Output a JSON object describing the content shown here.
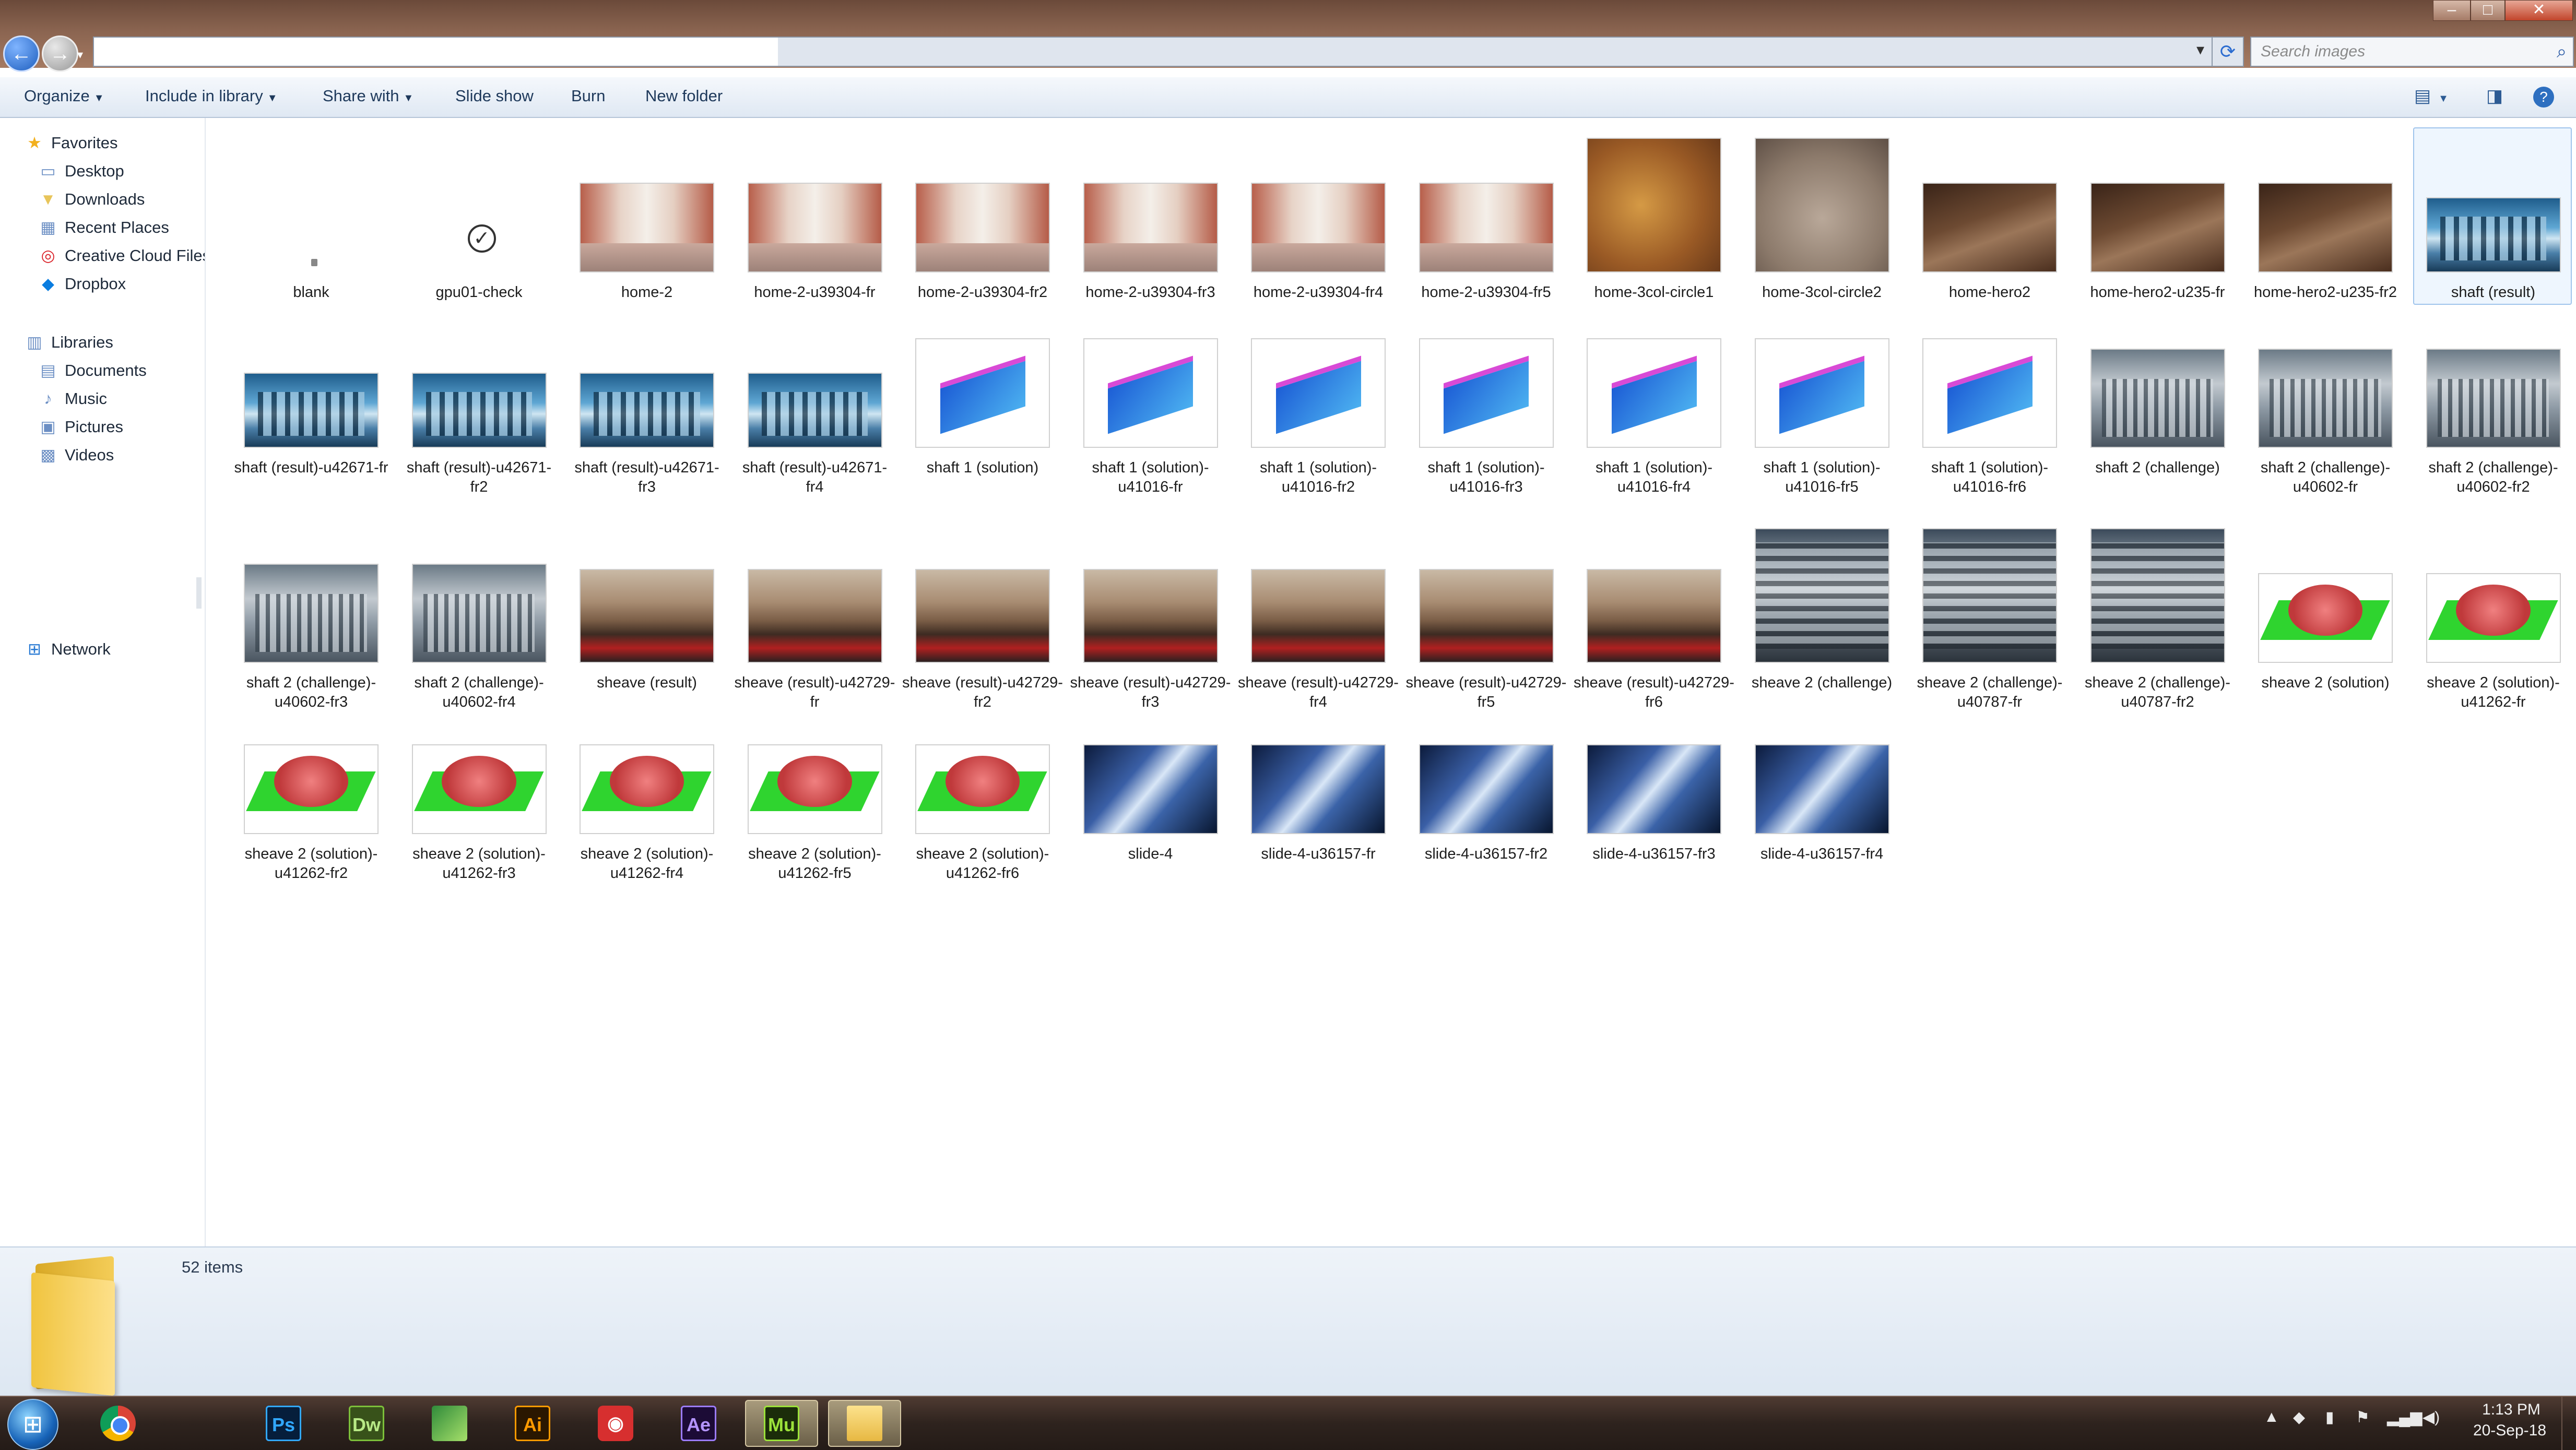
{
  "window": {
    "controls": {
      "minimize": "–",
      "maximize": "□",
      "close": "✕"
    },
    "nav": {
      "back_icon": "back-arrow-icon",
      "forward_icon": "forward-arrow-icon"
    },
    "address": {
      "value": "",
      "dropdown_icon": "▾"
    },
    "refresh_icon": "refresh-icon",
    "search": {
      "placeholder": "Search images",
      "icon": "search-icon"
    }
  },
  "toolbar": {
    "items": [
      {
        "label": "Organize",
        "dropdown": true
      },
      {
        "label": "Include in library",
        "dropdown": true
      },
      {
        "label": "Share with",
        "dropdown": true
      },
      {
        "label": "Slide show",
        "dropdown": false
      },
      {
        "label": "Burn",
        "dropdown": false
      },
      {
        "label": "New folder",
        "dropdown": false
      }
    ],
    "right_icons": [
      "view-options-icon",
      "preview-pane-icon",
      "help-icon"
    ]
  },
  "sidebar": {
    "favorites": {
      "label": "Favorites",
      "items": [
        "Desktop",
        "Downloads",
        "Recent Places",
        "Creative Cloud Files",
        "Dropbox"
      ]
    },
    "libraries": {
      "label": "Libraries",
      "items": [
        "Documents",
        "Music",
        "Pictures",
        "Videos"
      ]
    },
    "network": {
      "label": "Network"
    }
  },
  "files": [
    {
      "name": "blank",
      "kind": "blank"
    },
    {
      "name": "gpu01-check",
      "kind": "check"
    },
    {
      "name": "home-2",
      "kind": "warehouse"
    },
    {
      "name": "home-2-u39304-fr",
      "kind": "warehouse"
    },
    {
      "name": "home-2-u39304-fr2",
      "kind": "warehouse"
    },
    {
      "name": "home-2-u39304-fr3",
      "kind": "warehouse"
    },
    {
      "name": "home-2-u39304-fr4",
      "kind": "warehouse"
    },
    {
      "name": "home-2-u39304-fr5",
      "kind": "warehouse"
    },
    {
      "name": "home-3col-circle1",
      "kind": "blur1"
    },
    {
      "name": "home-3col-circle2",
      "kind": "blur2"
    },
    {
      "name": "home-hero2",
      "kind": "hero"
    },
    {
      "name": "home-hero2-u235-fr",
      "kind": "hero"
    },
    {
      "name": "home-hero2-u235-fr2",
      "kind": "hero"
    },
    {
      "name": "shaft (result)",
      "kind": "shaft",
      "selected": true
    },
    {
      "name": "shaft (result)-u42671-fr",
      "kind": "shaft"
    },
    {
      "name": "shaft (result)-u42671-fr2",
      "kind": "shaft"
    },
    {
      "name": "shaft (result)-u42671-fr3",
      "kind": "shaft"
    },
    {
      "name": "shaft (result)-u42671-fr4",
      "kind": "shaft"
    },
    {
      "name": "shaft 1 (solution)",
      "kind": "cad1"
    },
    {
      "name": "shaft 1 (solution)-u41016-fr",
      "kind": "cad1"
    },
    {
      "name": "shaft 1 (solution)-u41016-fr2",
      "kind": "cad1"
    },
    {
      "name": "shaft 1 (solution)-u41016-fr3",
      "kind": "cad1"
    },
    {
      "name": "shaft 1 (solution)-u41016-fr4",
      "kind": "cad1"
    },
    {
      "name": "shaft 1 (solution)-u41016-fr5",
      "kind": "cad1"
    },
    {
      "name": "shaft 1 (solution)-u41016-fr6",
      "kind": "cad1"
    },
    {
      "name": "shaft 2 (challenge)",
      "kind": "shaft2"
    },
    {
      "name": "shaft 2 (challenge)-u40602-fr",
      "kind": "shaft2"
    },
    {
      "name": "shaft 2 (challenge)-u40602-fr2",
      "kind": "shaft2"
    },
    {
      "name": "shaft 2 (challenge)-u40602-fr3",
      "kind": "shaft2"
    },
    {
      "name": "shaft 2 (challenge)-u40602-fr4",
      "kind": "shaft2"
    },
    {
      "name": "sheave (result)",
      "kind": "sheave"
    },
    {
      "name": "sheave (result)-u42729-fr",
      "kind": "sheave"
    },
    {
      "name": "sheave (result)-u42729-fr2",
      "kind": "sheave"
    },
    {
      "name": "sheave (result)-u42729-fr3",
      "kind": "sheave"
    },
    {
      "name": "sheave (result)-u42729-fr4",
      "kind": "sheave"
    },
    {
      "name": "sheave (result)-u42729-fr5",
      "kind": "sheave"
    },
    {
      "name": "sheave (result)-u42729-fr6",
      "kind": "sheave"
    },
    {
      "name": "sheave 2 (challenge)",
      "kind": "sheave2"
    },
    {
      "name": "sheave 2 (challenge)-u40787-fr",
      "kind": "sheave2"
    },
    {
      "name": "sheave 2 (challenge)-u40787-fr2",
      "kind": "sheave2"
    },
    {
      "name": "sheave 2 (solution)",
      "kind": "sheavesol"
    },
    {
      "name": "sheave 2 (solution)-u41262-fr",
      "kind": "sheavesol"
    },
    {
      "name": "sheave 2 (solution)-u41262-fr2",
      "kind": "sheavesol"
    },
    {
      "name": "sheave 2 (solution)-u41262-fr3",
      "kind": "sheavesol"
    },
    {
      "name": "sheave 2 (solution)-u41262-fr4",
      "kind": "sheavesol"
    },
    {
      "name": "sheave 2 (solution)-u41262-fr5",
      "kind": "sheavesol"
    },
    {
      "name": "sheave 2 (solution)-u41262-fr6",
      "kind": "sheavesol"
    },
    {
      "name": "slide-4",
      "kind": "slide"
    },
    {
      "name": "slide-4-u36157-fr",
      "kind": "slide"
    },
    {
      "name": "slide-4-u36157-fr2",
      "kind": "slide"
    },
    {
      "name": "slide-4-u36157-fr3",
      "kind": "slide"
    },
    {
      "name": "slide-4-u36157-fr4",
      "kind": "slide"
    }
  ],
  "status": {
    "item_count": "52 items"
  },
  "taskbar": {
    "apps": [
      {
        "name": "chrome",
        "icon": "",
        "active": false
      },
      {
        "name": "ps",
        "icon": "Ps",
        "active": false
      },
      {
        "name": "dw",
        "icon": "Dw",
        "active": false
      },
      {
        "name": "edge",
        "icon": "",
        "active": false
      },
      {
        "name": "ai",
        "icon": "Ai",
        "active": false
      },
      {
        "name": "camera",
        "icon": "◉",
        "active": false
      },
      {
        "name": "ae",
        "icon": "Ae",
        "active": false
      },
      {
        "name": "mu",
        "icon": "Mu",
        "active": true
      },
      {
        "name": "explorer",
        "icon": "",
        "active": true
      }
    ],
    "tray_icons": [
      "show-hidden-icon",
      "dropbox-tray-icon",
      "usb-icon",
      "flag-icon",
      "network-signal-icon",
      "volume-icon"
    ],
    "clock": {
      "time": "1:13 PM",
      "date": "20-Sep-18"
    }
  }
}
